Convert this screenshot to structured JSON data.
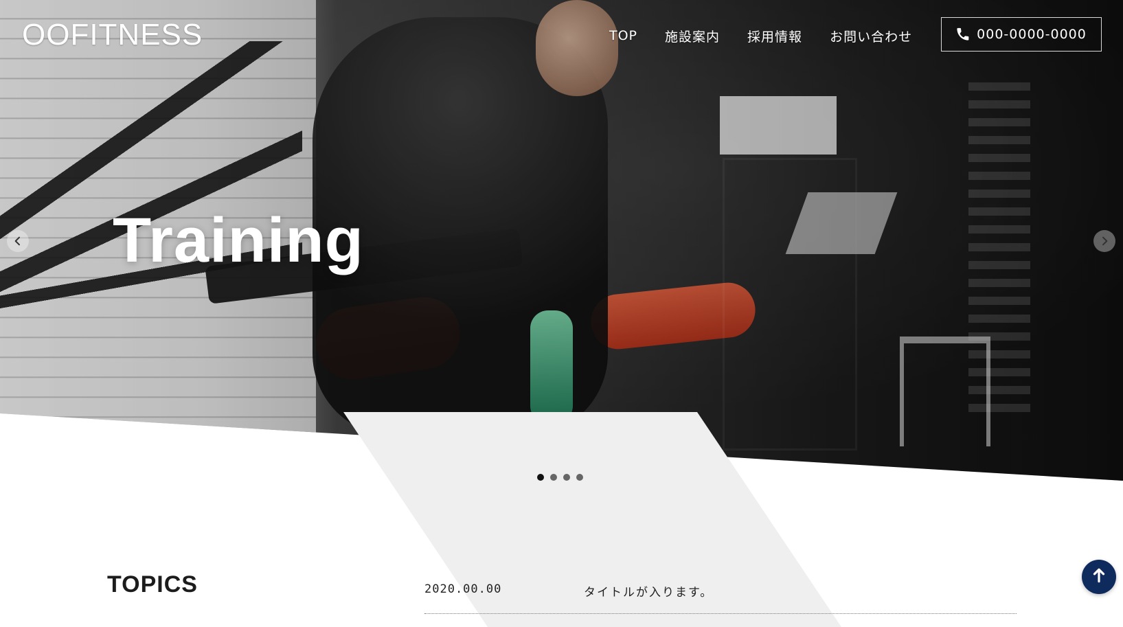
{
  "header": {
    "logo_text": "OOFITNESS",
    "nav": [
      {
        "label": "TOP"
      },
      {
        "label": "施設案内"
      },
      {
        "label": "採用情報"
      },
      {
        "label": "お問い合わせ"
      }
    ],
    "phone": {
      "icon": "phone-icon",
      "label": "000-0000-0000"
    }
  },
  "hero": {
    "title": "Training",
    "arrow_left_icon": "chevron-left-icon",
    "arrow_right_icon": "chevron-right-icon"
  },
  "slider": {
    "dots_total": 4,
    "active_index": 0
  },
  "topics": {
    "title": "TOPICS",
    "items": [
      {
        "date": "2020.00.00",
        "title": "タイトルが入ります。"
      }
    ]
  },
  "ui": {
    "back_to_top_icon": "arrow-up-icon",
    "accent": "#0f2a5c"
  }
}
